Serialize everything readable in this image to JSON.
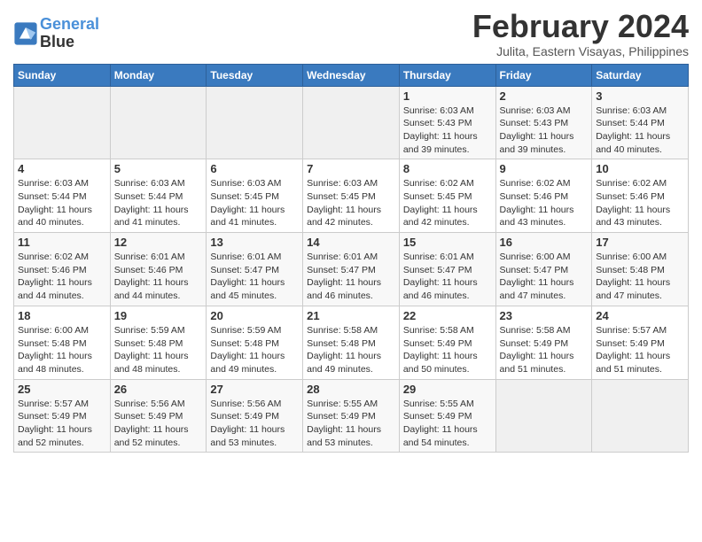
{
  "logo": {
    "line1": "General",
    "line2": "Blue"
  },
  "title": "February 2024",
  "subtitle": "Julita, Eastern Visayas, Philippines",
  "days_header": [
    "Sunday",
    "Monday",
    "Tuesday",
    "Wednesday",
    "Thursday",
    "Friday",
    "Saturday"
  ],
  "weeks": [
    [
      {
        "day": "",
        "info": ""
      },
      {
        "day": "",
        "info": ""
      },
      {
        "day": "",
        "info": ""
      },
      {
        "day": "",
        "info": ""
      },
      {
        "day": "1",
        "info": "Sunrise: 6:03 AM\nSunset: 5:43 PM\nDaylight: 11 hours\nand 39 minutes."
      },
      {
        "day": "2",
        "info": "Sunrise: 6:03 AM\nSunset: 5:43 PM\nDaylight: 11 hours\nand 39 minutes."
      },
      {
        "day": "3",
        "info": "Sunrise: 6:03 AM\nSunset: 5:44 PM\nDaylight: 11 hours\nand 40 minutes."
      }
    ],
    [
      {
        "day": "4",
        "info": "Sunrise: 6:03 AM\nSunset: 5:44 PM\nDaylight: 11 hours\nand 40 minutes."
      },
      {
        "day": "5",
        "info": "Sunrise: 6:03 AM\nSunset: 5:44 PM\nDaylight: 11 hours\nand 41 minutes."
      },
      {
        "day": "6",
        "info": "Sunrise: 6:03 AM\nSunset: 5:45 PM\nDaylight: 11 hours\nand 41 minutes."
      },
      {
        "day": "7",
        "info": "Sunrise: 6:03 AM\nSunset: 5:45 PM\nDaylight: 11 hours\nand 42 minutes."
      },
      {
        "day": "8",
        "info": "Sunrise: 6:02 AM\nSunset: 5:45 PM\nDaylight: 11 hours\nand 42 minutes."
      },
      {
        "day": "9",
        "info": "Sunrise: 6:02 AM\nSunset: 5:46 PM\nDaylight: 11 hours\nand 43 minutes."
      },
      {
        "day": "10",
        "info": "Sunrise: 6:02 AM\nSunset: 5:46 PM\nDaylight: 11 hours\nand 43 minutes."
      }
    ],
    [
      {
        "day": "11",
        "info": "Sunrise: 6:02 AM\nSunset: 5:46 PM\nDaylight: 11 hours\nand 44 minutes."
      },
      {
        "day": "12",
        "info": "Sunrise: 6:01 AM\nSunset: 5:46 PM\nDaylight: 11 hours\nand 44 minutes."
      },
      {
        "day": "13",
        "info": "Sunrise: 6:01 AM\nSunset: 5:47 PM\nDaylight: 11 hours\nand 45 minutes."
      },
      {
        "day": "14",
        "info": "Sunrise: 6:01 AM\nSunset: 5:47 PM\nDaylight: 11 hours\nand 46 minutes."
      },
      {
        "day": "15",
        "info": "Sunrise: 6:01 AM\nSunset: 5:47 PM\nDaylight: 11 hours\nand 46 minutes."
      },
      {
        "day": "16",
        "info": "Sunrise: 6:00 AM\nSunset: 5:47 PM\nDaylight: 11 hours\nand 47 minutes."
      },
      {
        "day": "17",
        "info": "Sunrise: 6:00 AM\nSunset: 5:48 PM\nDaylight: 11 hours\nand 47 minutes."
      }
    ],
    [
      {
        "day": "18",
        "info": "Sunrise: 6:00 AM\nSunset: 5:48 PM\nDaylight: 11 hours\nand 48 minutes."
      },
      {
        "day": "19",
        "info": "Sunrise: 5:59 AM\nSunset: 5:48 PM\nDaylight: 11 hours\nand 48 minutes."
      },
      {
        "day": "20",
        "info": "Sunrise: 5:59 AM\nSunset: 5:48 PM\nDaylight: 11 hours\nand 49 minutes."
      },
      {
        "day": "21",
        "info": "Sunrise: 5:58 AM\nSunset: 5:48 PM\nDaylight: 11 hours\nand 49 minutes."
      },
      {
        "day": "22",
        "info": "Sunrise: 5:58 AM\nSunset: 5:49 PM\nDaylight: 11 hours\nand 50 minutes."
      },
      {
        "day": "23",
        "info": "Sunrise: 5:58 AM\nSunset: 5:49 PM\nDaylight: 11 hours\nand 51 minutes."
      },
      {
        "day": "24",
        "info": "Sunrise: 5:57 AM\nSunset: 5:49 PM\nDaylight: 11 hours\nand 51 minutes."
      }
    ],
    [
      {
        "day": "25",
        "info": "Sunrise: 5:57 AM\nSunset: 5:49 PM\nDaylight: 11 hours\nand 52 minutes."
      },
      {
        "day": "26",
        "info": "Sunrise: 5:56 AM\nSunset: 5:49 PM\nDaylight: 11 hours\nand 52 minutes."
      },
      {
        "day": "27",
        "info": "Sunrise: 5:56 AM\nSunset: 5:49 PM\nDaylight: 11 hours\nand 53 minutes."
      },
      {
        "day": "28",
        "info": "Sunrise: 5:55 AM\nSunset: 5:49 PM\nDaylight: 11 hours\nand 53 minutes."
      },
      {
        "day": "29",
        "info": "Sunrise: 5:55 AM\nSunset: 5:49 PM\nDaylight: 11 hours\nand 54 minutes."
      },
      {
        "day": "",
        "info": ""
      },
      {
        "day": "",
        "info": ""
      }
    ]
  ]
}
